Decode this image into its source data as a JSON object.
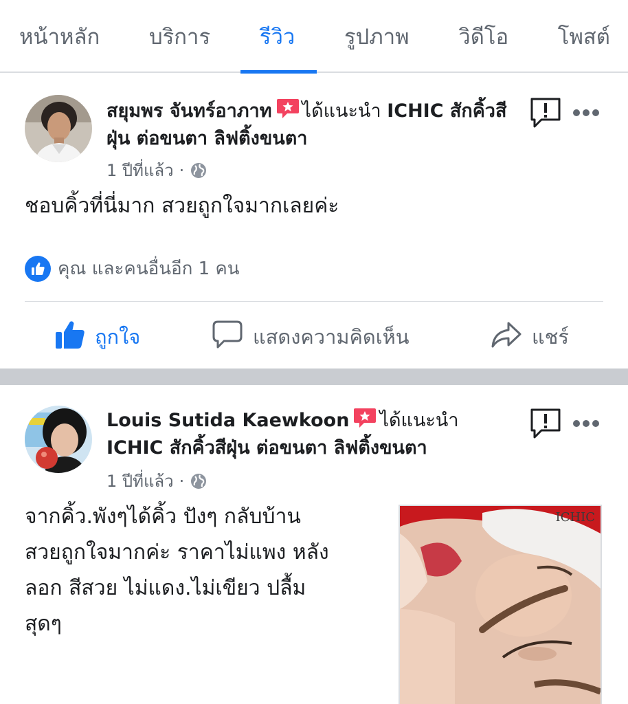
{
  "tabs": [
    {
      "label": "หน้าหลัก",
      "active": false
    },
    {
      "label": "บริการ",
      "active": false
    },
    {
      "label": "รีวิว",
      "active": true
    },
    {
      "label": "รูปภาพ",
      "active": false
    },
    {
      "label": "วิดีโอ",
      "active": false
    },
    {
      "label": "โพสต์",
      "active": false
    }
  ],
  "posts": [
    {
      "author": "สยุมพร จันทร์อาภาท",
      "recommend_text": "ได้แนะนำ",
      "page_name": "ICHIC สักคิ้วสีฝุ่น ต่อขนตา ลิฟติ้งขนตา",
      "time": "1 ปีที่แล้ว",
      "text": "ชอบคิ้วที่นี่มาก สวยถูกใจมากเลยค่ะ",
      "reactions": "คุณ และคนอื่นอีก 1 คน",
      "actions": {
        "like": "ถูกใจ",
        "comment": "แสดงความคิดเห็น",
        "share": "แชร์"
      }
    },
    {
      "author": "Louis Sutida Kaewkoon",
      "recommend_text": "ได้แนะนำ",
      "page_name": "ICHIC สักคิ้วสีฝุ่น ต่อขนตา ลิฟติ้งขนตา",
      "time": "1 ปีที่แล้ว",
      "text_lines": [
        "จากคิ้ว.พังๆได้คิ้ว ปังๆ กลับบ้าน",
        "สวยถูกใจมากค่ะ ราคาไม่แพง หลัง",
        "ลอก สีสวย ไม่แดง.ไม่เขียว ปลื้ม",
        "สุดๆ"
      ],
      "photo_watermark": "ICHIC"
    }
  ],
  "colors": {
    "accent": "#1877f2",
    "secondary_text": "#606770",
    "separator": "#c9ccd1",
    "badge": "#f3425f"
  }
}
